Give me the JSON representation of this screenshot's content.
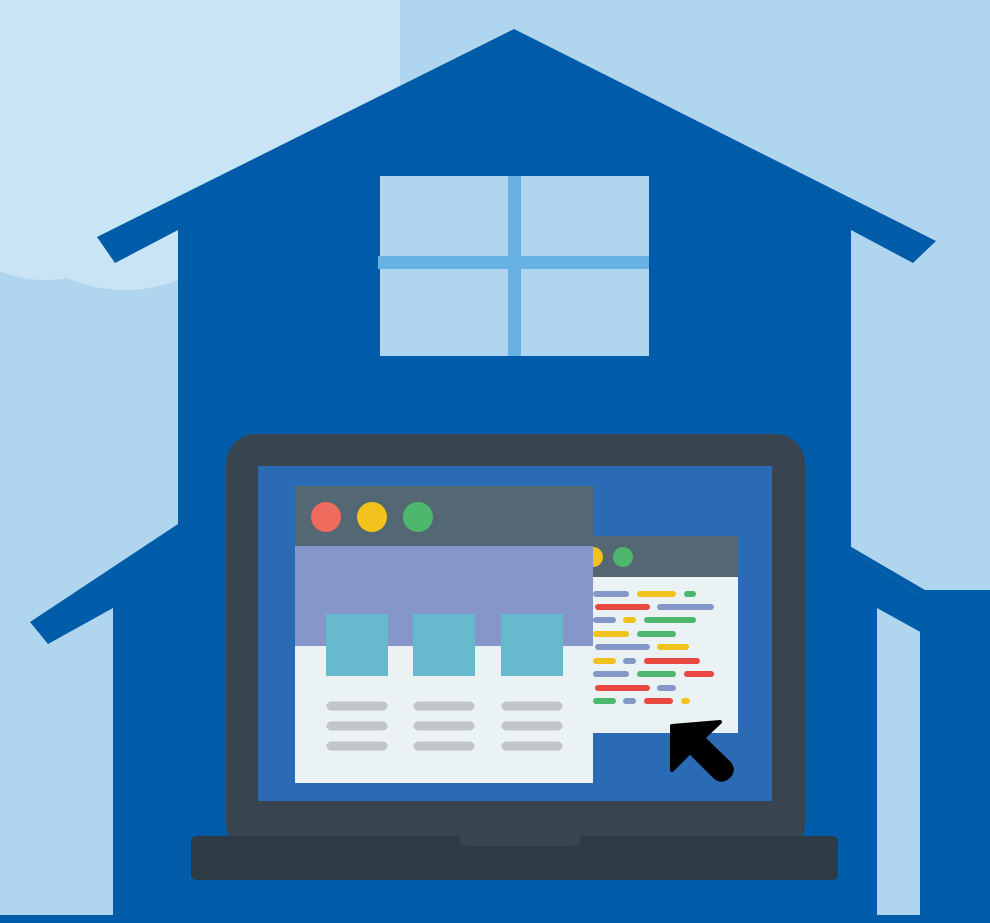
{
  "scene": {
    "subject": "house-with-laptop-illustration",
    "colors": {
      "sky": "#b0d6ef",
      "cloud": "#c8e4f5",
      "house": "#005ba8",
      "window_glass": "#b0d6ef",
      "window_frame": "#65b2e3",
      "laptop_body": "#384550",
      "laptop_base": "#2d3c44",
      "screen": "#2b6bb5",
      "browser_titlebar": "#536873",
      "browser_hero": "#8596c9",
      "browser_body": "#eaf2f3",
      "card": "#67b9cd",
      "text_line": "#c2c6c9",
      "dot_red": "#ee6b5d",
      "dot_yellow": "#f1c21b",
      "dot_green": "#4eb76e",
      "code_red": "#e8483f",
      "code_yellow": "#f1c21b",
      "code_green": "#4eb76e",
      "code_purple": "#8596c9",
      "cursor": "#000000"
    },
    "icons": [
      "house-icon",
      "window-icon",
      "laptop-icon",
      "browser-window-icon",
      "code-editor-icon",
      "cursor-arrow-icon"
    ]
  }
}
